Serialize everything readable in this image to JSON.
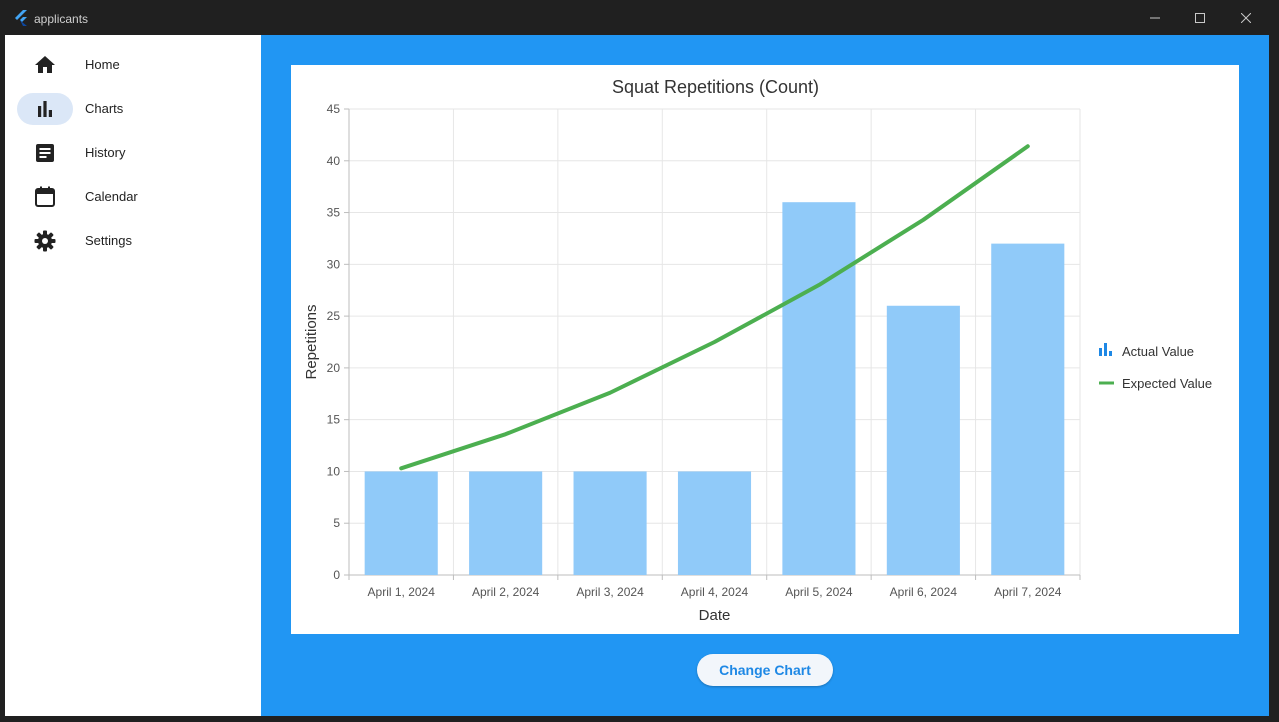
{
  "window": {
    "title": "applicants"
  },
  "sidebar": {
    "items": [
      {
        "label": "Home",
        "icon": "home-icon",
        "active": false
      },
      {
        "label": "Charts",
        "icon": "bar-chart-icon",
        "active": true
      },
      {
        "label": "History",
        "icon": "history-icon",
        "active": false
      },
      {
        "label": "Calendar",
        "icon": "calendar-icon",
        "active": false
      },
      {
        "label": "Settings",
        "icon": "gear-icon",
        "active": false
      }
    ]
  },
  "main": {
    "change_button": "Change Chart"
  },
  "colors": {
    "main_bg": "#2196f3",
    "bar": "#90caf9",
    "line": "#4caf50",
    "accent": "#1e88e5"
  },
  "chart_data": {
    "type": "bar",
    "title": "Squat Repetitions (Count)",
    "xlabel": "Date",
    "ylabel": "Repetitions",
    "categories": [
      "April 1, 2024",
      "April 2, 2024",
      "April 3, 2024",
      "April 4, 2024",
      "April 5, 2024",
      "April 6, 2024",
      "April 7, 2024"
    ],
    "ylim": [
      0,
      45
    ],
    "yticks": [
      0,
      5,
      10,
      15,
      20,
      25,
      30,
      35,
      40,
      45
    ],
    "grid": true,
    "legend_position": "right",
    "series": [
      {
        "name": "Actual Value",
        "type": "bar",
        "values": [
          10,
          10,
          10,
          10,
          36,
          26,
          32
        ]
      },
      {
        "name": "Expected Value",
        "type": "line",
        "values": [
          10.3,
          13.6,
          17.6,
          22.5,
          28.0,
          34.3,
          41.4
        ]
      }
    ]
  }
}
